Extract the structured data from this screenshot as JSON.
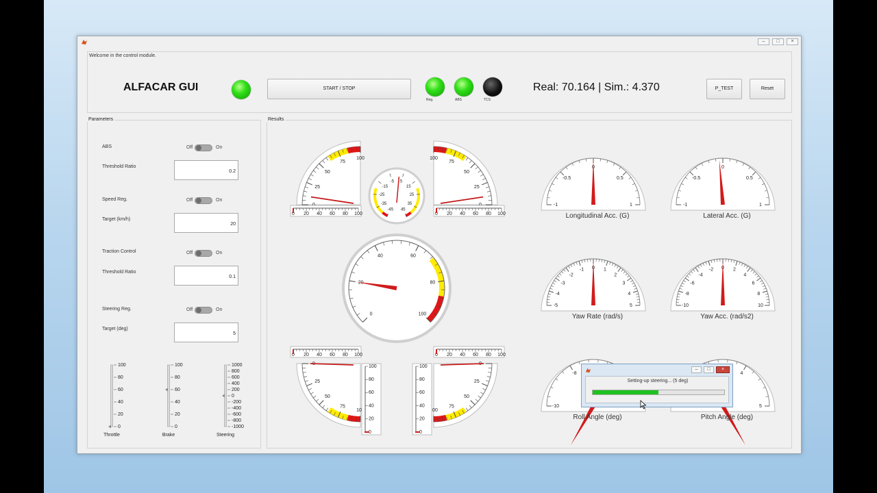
{
  "window": {
    "status_message": "Welcome in the control module.",
    "app_title": "ALFACAR GUI",
    "start_stop_label": "START / STOP",
    "lamps": [
      {
        "label": "Reg.",
        "state": "on"
      },
      {
        "label": "ABS",
        "state": "on"
      },
      {
        "label": "TCS",
        "state": "off"
      }
    ],
    "timer_text": "Real: 70.164 | Sim.: 4.370",
    "ptest_label": "P_TEST",
    "reset_label": "Reset"
  },
  "parameters": {
    "title": "Parameters",
    "off": "Off",
    "on": "On",
    "abs_label": "ABS",
    "abs_threshold_label": "Threshold Ratio",
    "abs_threshold_value": "0.2",
    "speed_label": "Speed Reg.",
    "speed_target_label": "Target (km/h)",
    "speed_target_value": "20",
    "traction_label": "Traction Control",
    "traction_threshold_label": "Threshold Ratio",
    "traction_threshold_value": "0.1",
    "steering_label": "Steering Reg.",
    "steering_target_label": "Target (deg)",
    "steering_target_value": "5",
    "sliders": [
      {
        "label": "Throttle",
        "ticks": [
          "100",
          "80",
          "60",
          "40",
          "20",
          "0"
        ],
        "value": 0
      },
      {
        "label": "Brake",
        "ticks": [
          "100",
          "80",
          "60",
          "40",
          "20",
          "0"
        ],
        "value": 60
      },
      {
        "label": "Steering",
        "ticks": [
          "1000",
          "800",
          "600",
          "400",
          "200",
          "0",
          "-200",
          "-400",
          "-600",
          "-800",
          "-1000"
        ],
        "value": 0
      }
    ]
  },
  "results": {
    "title": "Results",
    "linear_ticks": [
      "0",
      "20",
      "40",
      "60",
      "80",
      "100"
    ],
    "wheel_gauges": [
      {
        "id": "fl",
        "value": 10
      },
      {
        "id": "fr",
        "value": 10
      },
      {
        "id": "rl",
        "value": 0
      },
      {
        "id": "rr",
        "value": 0
      }
    ],
    "wheel_gauge_ticks": [
      "0",
      "25",
      "50",
      "75",
      "100"
    ],
    "small_gauge": {
      "ticks": [
        "-45",
        "-35",
        "-25",
        "-15",
        "-5",
        "5",
        "15",
        "25",
        "35",
        "45"
      ],
      "value": 2
    },
    "speed_gauge": {
      "ticks": [
        "0",
        "20",
        "40",
        "60",
        "80",
        "100"
      ],
      "value": 20
    },
    "dials": [
      {
        "label": "Longitudinal Acc. (G)",
        "ticks": [
          "-1",
          "-0.5",
          "0",
          "0.5",
          "1"
        ],
        "value": 0
      },
      {
        "label": "Lateral Acc. (G)",
        "ticks": [
          "-1",
          "-0.5",
          "0",
          "0.5",
          "1"
        ],
        "value": -0.05
      },
      {
        "label": "Yaw Rate (rad/s)",
        "ticks": [
          "-5",
          "-4",
          "-3",
          "-2",
          "-1",
          "0",
          "1",
          "2",
          "3",
          "4",
          "5"
        ],
        "value": 0
      },
      {
        "label": "Yaw Acc. (rad/s2)",
        "ticks": [
          "-10",
          "-8",
          "-6",
          "-4",
          "-2",
          "0",
          "2",
          "4",
          "6",
          "8",
          "10"
        ],
        "value": 0
      },
      {
        "label": "Roll Angle (deg)",
        "ticks": [
          "-10",
          "-8",
          "-6",
          "-4"
        ],
        "value": 0
      },
      {
        "label": "Pitch Angle (deg)",
        "ticks": [
          "2",
          "3",
          "4",
          "5"
        ],
        "value": 0
      }
    ]
  },
  "dialog": {
    "message": "Setting-up steering... (5 deg)",
    "progress": 0.5
  }
}
